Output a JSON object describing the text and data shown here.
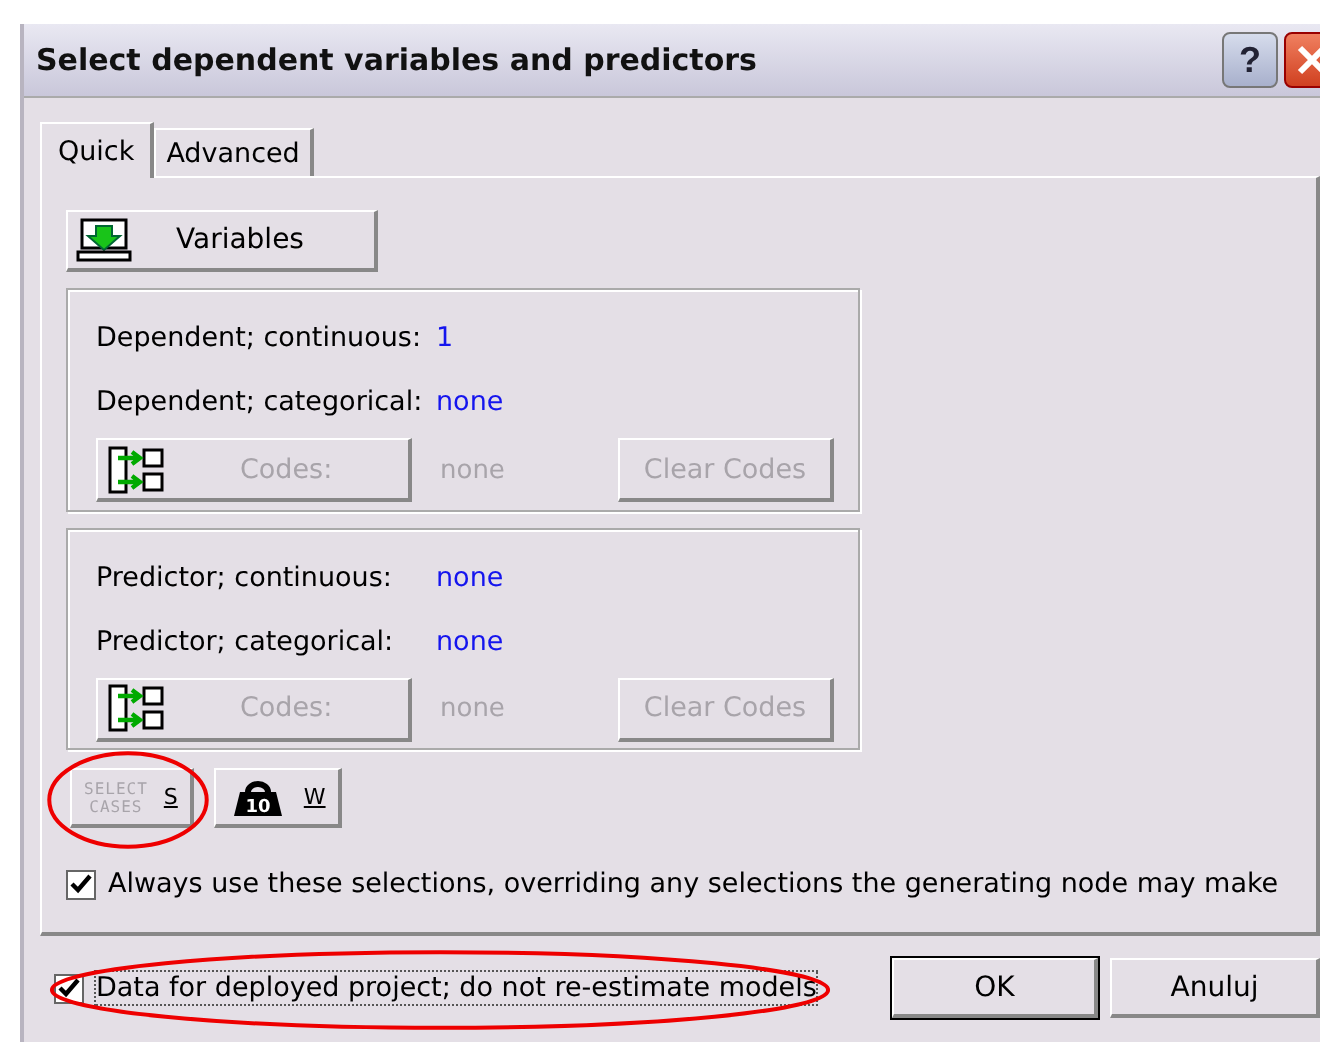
{
  "window": {
    "title": "Select dependent variables and predictors",
    "help_label": "?"
  },
  "tabs": [
    {
      "label": "Quick",
      "selected": true
    },
    {
      "label": "Advanced",
      "selected": false
    }
  ],
  "variables_button": {
    "label": "Variables"
  },
  "groups": [
    {
      "rows": [
        {
          "label": "Dependent; continuous:",
          "value": "1"
        },
        {
          "label": "Dependent; categorical:",
          "value": "none"
        }
      ],
      "codes_button": {
        "label": "Codes:",
        "disabled": true
      },
      "codes_value": "none",
      "clear_button": {
        "label": "Clear Codes",
        "disabled": true
      }
    },
    {
      "rows": [
        {
          "label": "Predictor; continuous:",
          "value": "none"
        },
        {
          "label": "Predictor; categorical:",
          "value": "none"
        }
      ],
      "codes_button": {
        "label": "Codes:",
        "disabled": true
      },
      "codes_value": "none",
      "clear_button": {
        "label": "Clear Codes",
        "disabled": true
      }
    }
  ],
  "small_buttons": [
    {
      "kind": "select-cases",
      "icon_text": [
        "SELECT",
        "CASES"
      ],
      "label": "S",
      "highlighted": true
    },
    {
      "kind": "weight",
      "icon_text": [
        "10"
      ],
      "label": "W",
      "highlighted": false
    }
  ],
  "always_use": {
    "label": "Always use these selections, overriding any selections the generating node may make",
    "checked": true
  },
  "deployed": {
    "label": "Data for deployed project; do not re-estimate models",
    "checked": true,
    "highlighted": true
  },
  "buttons": [
    "OK",
    "Anuluj"
  ]
}
